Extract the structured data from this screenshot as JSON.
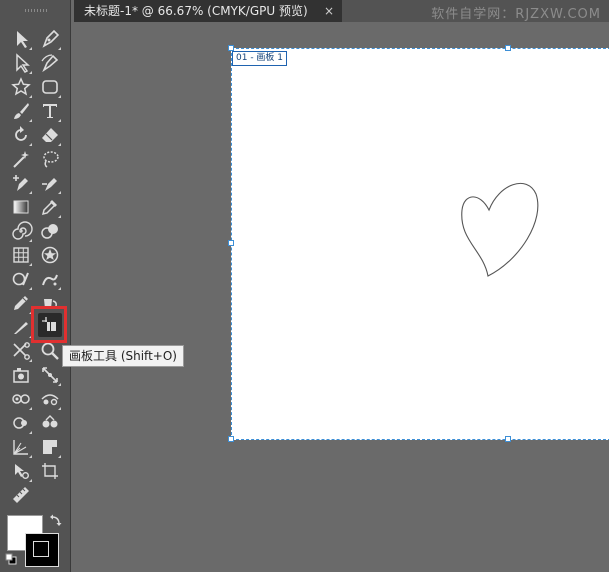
{
  "document": {
    "tab_title": "未标题-1* @ 66.67% (CMYK/GPU 预览)",
    "close_glyph": "×",
    "watermark": "软件自学网：RJZXW.COM"
  },
  "artboard": {
    "label": "01 - 画板 1"
  },
  "tooltip": {
    "text": "画板工具 (Shift+O)"
  },
  "toolbar": {
    "tools": [
      {
        "name": "selection-tool",
        "icon": "arrow-icon"
      },
      {
        "name": "pen-tool",
        "icon": "pen-icon"
      },
      {
        "name": "direct-selection-tool",
        "icon": "hollow-arrow-icon"
      },
      {
        "name": "curvature-tool",
        "icon": "curvature-pen-icon"
      },
      {
        "name": "star-tool",
        "icon": "star-icon"
      },
      {
        "name": "rectangle-tool",
        "icon": "rounded-rect-icon"
      },
      {
        "name": "paintbrush-tool",
        "icon": "brush-icon"
      },
      {
        "name": "type-tool",
        "icon": "type-icon"
      },
      {
        "name": "rotate-tool",
        "icon": "rotate-icon"
      },
      {
        "name": "eraser-tool",
        "icon": "eraser-icon"
      },
      {
        "name": "magic-wand-tool",
        "icon": "magic-wand-icon"
      },
      {
        "name": "lasso-tool",
        "icon": "lasso-icon"
      },
      {
        "name": "anchor-point-tool",
        "icon": "anchor-plus-icon"
      },
      {
        "name": "width-tool",
        "icon": "width-icon"
      },
      {
        "name": "gradient-tool",
        "icon": "gradient-icon"
      },
      {
        "name": "eyedropper-tool",
        "icon": "eyedropper-icon"
      },
      {
        "name": "twirl-tool",
        "icon": "spiral-icon"
      },
      {
        "name": "blend-tool",
        "icon": "blend-icon"
      },
      {
        "name": "mesh-tool",
        "icon": "grid-icon"
      },
      {
        "name": "symbol-tool",
        "icon": "symbol-icon"
      },
      {
        "name": "shape-builder-tool",
        "icon": "shape-builder-icon"
      },
      {
        "name": "symbol-sprayer-tool",
        "icon": "spray-icon"
      },
      {
        "name": "pencil-tool",
        "icon": "pencil-icon"
      },
      {
        "name": "live-paint-tool",
        "icon": "bucket-icon"
      },
      {
        "name": "knife-tool",
        "icon": "knife-icon"
      },
      {
        "name": "artboard-tool",
        "icon": "artboard-icon"
      },
      {
        "name": "scissors-tool",
        "icon": "scissors-icon"
      },
      {
        "name": "zoom-tool",
        "icon": "magnifier-icon"
      },
      {
        "name": "perspective-tool",
        "icon": "camera-icon"
      },
      {
        "name": "scale-tool",
        "icon": "scale-icon"
      },
      {
        "name": "warp-tool",
        "icon": "warp-icon"
      },
      {
        "name": "pucker-tool",
        "icon": "pucker-icon"
      },
      {
        "name": "reflect-tool",
        "icon": "reflect-icon"
      },
      {
        "name": "bloat-tool",
        "icon": "bloat-icon"
      },
      {
        "name": "graph-tool",
        "icon": "graph-icon"
      },
      {
        "name": "slice-tool",
        "icon": "flag-icon"
      },
      {
        "name": "puppet-warp-tool",
        "icon": "puppet-icon"
      },
      {
        "name": "crop-tool",
        "icon": "page-icon"
      },
      {
        "name": "ruler-tool",
        "icon": "ruler-icon"
      }
    ]
  },
  "colors": {
    "fill": "#ffffff",
    "stroke": "#000000",
    "artboard_border": "#3d8fd6",
    "highlight": "#e03030"
  }
}
